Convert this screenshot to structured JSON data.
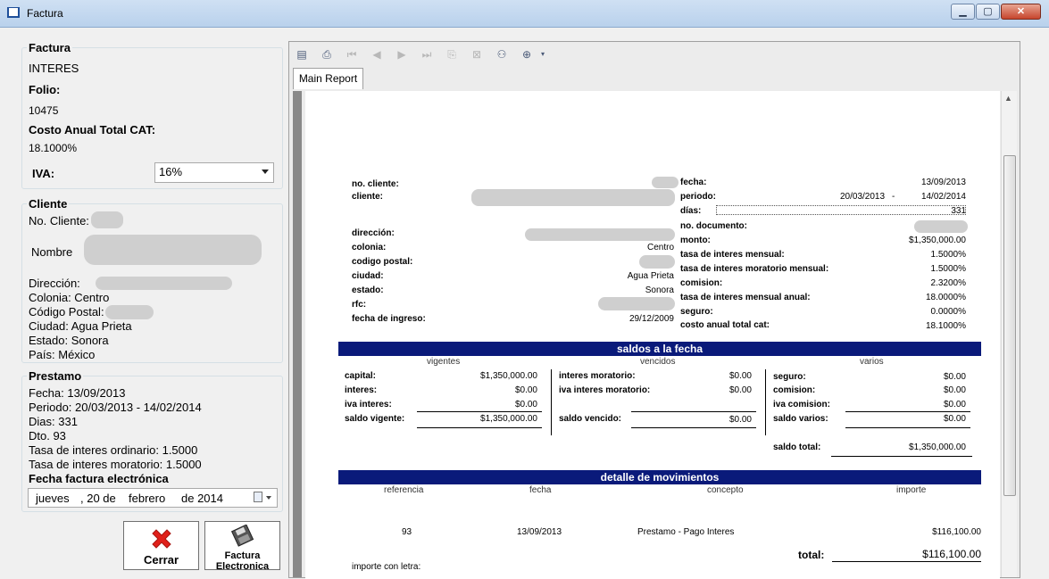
{
  "window": {
    "title": "Factura",
    "minimize": "▁",
    "maximize": "▢",
    "close": "✕"
  },
  "factura": {
    "legend": "Factura",
    "tipo": "INTERES",
    "folio_label": "Folio:",
    "folio": "10475",
    "cat_label": "Costo Anual Total CAT:",
    "cat": "18.1000%",
    "iva_label": "IVA:",
    "iva_value": "16%"
  },
  "cliente": {
    "legend": "Cliente",
    "no_cliente": "No. Cliente:",
    "nombre": "Nombre",
    "direccion": "Dirección:",
    "colonia": "Colonia: Centro",
    "codigo_postal": "Código Postal:",
    "ciudad": "Ciudad: Agua Prieta",
    "estado": "Estado: Sonora",
    "pais": "País: México"
  },
  "prestamo": {
    "legend": "Prestamo",
    "fecha": "Fecha: 13/09/2013",
    "periodo": "Periodo: 20/03/2013 - 14/02/2014",
    "dias": "Dias: 331",
    "dto": "Dto. 93",
    "tasa_ordinario": "Tasa de interes ordinario: 1.5000",
    "tasa_moratorio": "Tasa de interes moratorio: 1.5000",
    "fecha_factura_label": "Fecha factura electrónica",
    "date_day": "jueves",
    "date_num": ", 20 de",
    "date_month": "febrero",
    "date_year": "de 2014"
  },
  "buttons": {
    "cerrar": "Cerrar",
    "factura_electronica_1": "Factura",
    "factura_electronica_2": "Electronica"
  },
  "viewer": {
    "tab": "Main Report"
  },
  "report": {
    "labels": {
      "no_cliente": "no. cliente:",
      "cliente": "cliente:",
      "direccion": "dirección:",
      "colonia": "colonia:",
      "codigo_postal": "codigo postal:",
      "ciudad": "ciudad:",
      "estado": "estado:",
      "rfc": "rfc:",
      "fecha_ingreso": "fecha de ingreso:",
      "fecha": "fecha:",
      "periodo": "periodo:",
      "dias": "días:",
      "no_documento": "no. documento:",
      "monto": "monto:",
      "tasa_mensual": "tasa de interes mensual:",
      "tasa_moratorio_mensual": "tasa de interes moratorio mensual:",
      "comision": "comision:",
      "tasa_mensual_anual": "tasa de interes mensual anual:",
      "seguro": "seguro:",
      "cat": "costo anual total cat:"
    },
    "values": {
      "colonia": "Centro",
      "ciudad": "Agua Prieta",
      "estado": "Sonora",
      "fecha_ingreso": "29/12/2009",
      "fecha": "13/09/2013",
      "periodo_inicio": "20/03/2013",
      "periodo_sep": "-",
      "periodo_fin": "14/02/2014",
      "dias": "331",
      "monto": "$1,350,000.00",
      "tasa_mensual": "1.5000%",
      "tasa_moratorio_mensual": "1.5000%",
      "comision": "2.3200%",
      "tasa_mensual_anual": "18.0000%",
      "seguro": "0.0000%",
      "cat": "18.1000%"
    },
    "saldos": {
      "title": "saldos a la fecha",
      "vigentes": "vigentes",
      "vencidos": "vencidos",
      "varios": "varios",
      "capital_l": "capital:",
      "capital_v": "$1,350,000.00",
      "interes_l": "interes:",
      "interes_v": "$0.00",
      "iva_interes_l": "iva interes:",
      "iva_interes_v": "$0.00",
      "saldo_vigente_l": "saldo vigente:",
      "saldo_vigente_v": "$1,350,000.00",
      "int_mor_l": "interes moratorio:",
      "int_mor_v": "$0.00",
      "iva_int_mor_l": "iva interes moratorio:",
      "iva_int_mor_v": "$0.00",
      "saldo_vencido_l": "saldo vencido:",
      "saldo_vencido_v": "$0.00",
      "seguro_l": "seguro:",
      "seguro_v": "$0.00",
      "comision_l": "comision:",
      "comision_v": "$0.00",
      "iva_comision_l": "iva comision:",
      "iva_comision_v": "$0.00",
      "saldo_varios_l": "saldo varios:",
      "saldo_varios_v": "$0.00",
      "saldo_total_l": "saldo total:",
      "saldo_total_v": "$1,350,000.00"
    },
    "movimientos": {
      "title": "detalle de movimientos",
      "cols": [
        "referencia",
        "fecha",
        "concepto",
        "importe"
      ],
      "row": {
        "referencia": "93",
        "fecha": "13/09/2013",
        "concepto": "Prestamo - Pago Interes",
        "importe": "$116,100.00"
      },
      "total_l": "total:",
      "total_v": "$116,100.00",
      "importe_letra": "importe con letra:"
    }
  }
}
